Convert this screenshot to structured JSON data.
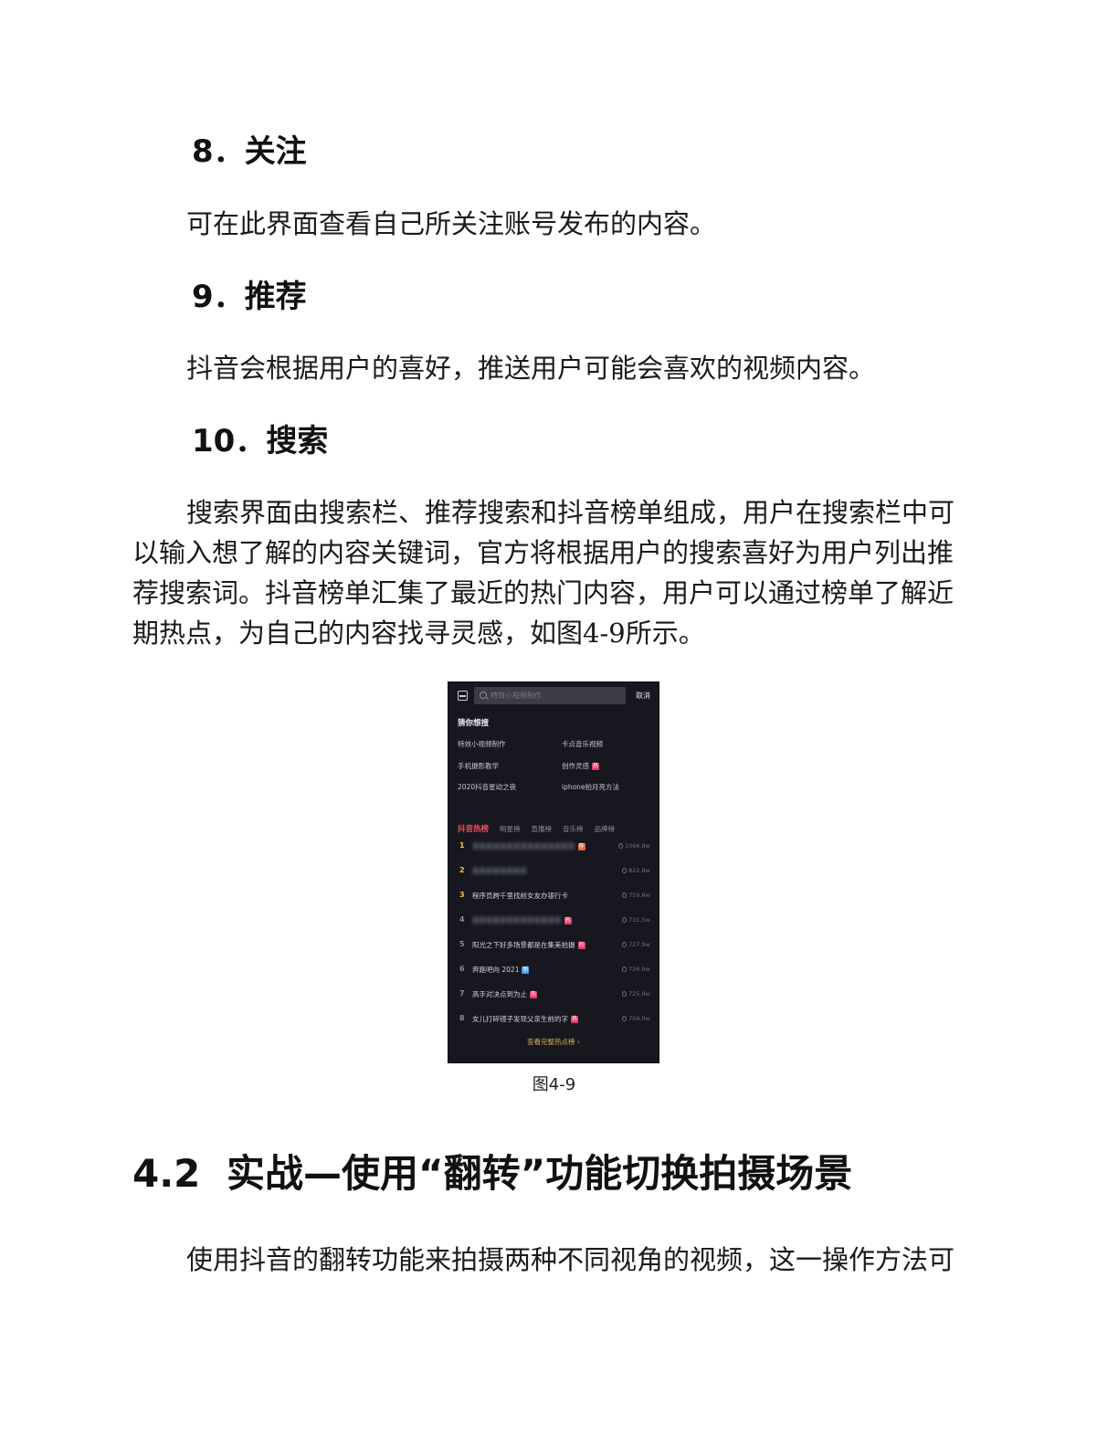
{
  "sections": [
    {
      "heading": "8．关注",
      "body": "可在此界面查看自己所关注账号发布的内容。"
    },
    {
      "heading": "9．推荐",
      "body": "抖音会根据用户的喜好，推送用户可能会喜欢的视频内容。"
    },
    {
      "heading": "10．搜索",
      "body_lines": [
        "搜索界面由搜索栏、推荐搜索和抖音榜单组成，用户在搜索栏中可",
        "以输入想了解的内容关键词，官方将根据用户的搜索喜好为用户列出推",
        "荐搜索词。抖音榜单汇集了最近的热门内容，用户可以通过榜单了解近",
        "期热点，为自己的内容找寻灵感，如图4-9所示。"
      ]
    }
  ],
  "figure": {
    "caption": "图4-9",
    "screen": {
      "search_placeholder": "特效小视频制作",
      "cancel_label": "取消",
      "suggest_title": "猜你想搜",
      "suggestions": [
        {
          "text": "特效小视频制作",
          "badge": ""
        },
        {
          "text": "卡点音乐视频",
          "badge": ""
        },
        {
          "text": "手机摄影教学",
          "badge": ""
        },
        {
          "text": "创作灵感",
          "badge": "热"
        },
        {
          "text": "2020抖音星动之夜",
          "badge": ""
        },
        {
          "text": "iphone拍月亮方法",
          "badge": ""
        }
      ],
      "tabs": [
        "抖音热榜",
        "明星榜",
        "直播榜",
        "音乐榜",
        "品牌榜"
      ],
      "ranks": [
        {
          "num": "1",
          "title": "某某某某某某某某某某某某某某某",
          "blurred": true,
          "badge": "荐",
          "heat": "1066.8w"
        },
        {
          "num": "2",
          "title": "某某某某某某某某",
          "blurred": true,
          "badge": "",
          "heat": "822.8w"
        },
        {
          "num": "3",
          "title": "程序员跨千里找前女友办银行卡",
          "blurred": false,
          "badge": "",
          "heat": "759.6w"
        },
        {
          "num": "4",
          "title": "某某某某某某某某某某某某某",
          "blurred": true,
          "badge": "热",
          "heat": "731.5w"
        },
        {
          "num": "5",
          "title": "阳光之下好多场景都是在集美拍摄",
          "blurred": false,
          "badge": "热",
          "heat": "727.9w"
        },
        {
          "num": "6",
          "title": "奔跑吧向 2021",
          "blurred": false,
          "badge": "新",
          "heat": "726.9w"
        },
        {
          "num": "7",
          "title": "高手对决点到为止",
          "blurred": false,
          "badge": "热",
          "heat": "725.9w"
        },
        {
          "num": "8",
          "title": "女儿打碎镜子发现父亲生前的字",
          "blurred": false,
          "badge": "热",
          "heat": "704.0w"
        }
      ],
      "more_label": "查看完整热点榜"
    }
  },
  "section_2": {
    "number": "4.2",
    "title": "实战—使用“翻转”功能切换拍摄场景",
    "body": "使用抖音的翻转功能来拍摄两种不同视角的视频，这一操作方法可"
  }
}
